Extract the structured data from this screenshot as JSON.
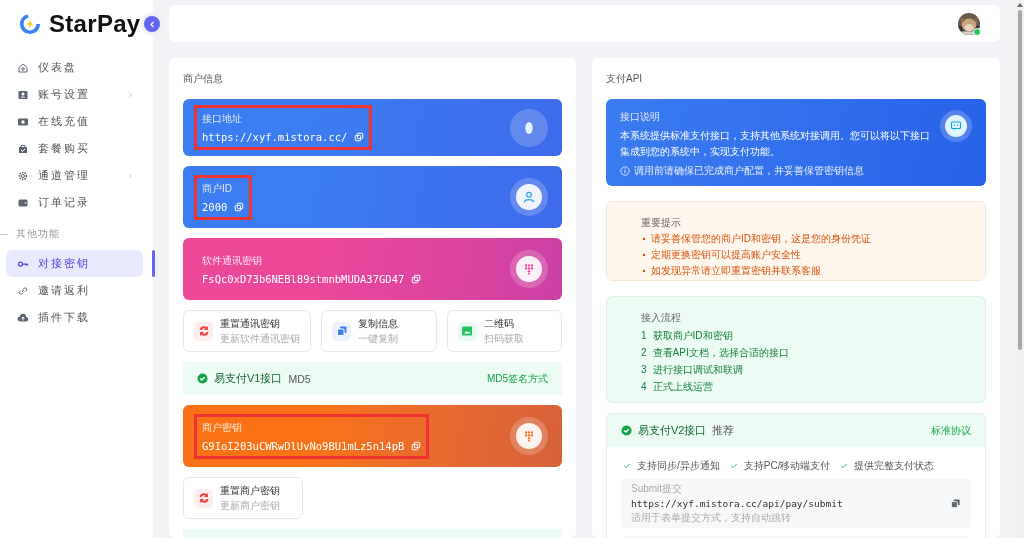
{
  "brand": {
    "name": "StarPay"
  },
  "sidebar": {
    "items": [
      {
        "label": "仪表盘",
        "has_submenu": false,
        "selected": false
      },
      {
        "label": "账号设置",
        "has_submenu": true,
        "selected": false
      },
      {
        "label": "在线充值",
        "has_submenu": false,
        "selected": false
      },
      {
        "label": "套餐购买",
        "has_submenu": false,
        "selected": false
      },
      {
        "label": "通道管理",
        "has_submenu": true,
        "selected": false
      },
      {
        "label": "订单记录",
        "has_submenu": false,
        "selected": false
      }
    ],
    "section": {
      "title": "其他功能",
      "items": [
        {
          "label": "对接密钥",
          "has_submenu": false,
          "selected": true
        },
        {
          "label": "邀请返利",
          "has_submenu": false,
          "selected": false
        },
        {
          "label": "插件下载",
          "has_submenu": false,
          "selected": false
        }
      ]
    }
  },
  "header": {
    "user": {
      "online": true
    }
  },
  "merchant_panel": {
    "title": "商户信息",
    "blocks": [
      {
        "kind": "credential",
        "color": "#3b7cf0",
        "label": "接口地址",
        "value": "https://xyf.mistora.cc/",
        "highlighted": true
      },
      {
        "kind": "credential",
        "color": "#3b7cf0",
        "label": "商户ID",
        "value": "2000",
        "highlighted": true
      },
      {
        "kind": "credential",
        "color": "#ec4899",
        "label": "软件通讯密钥",
        "value": "FsQc0xD73b6NEBl89stmnbMUDA37GD47",
        "highlighted": false
      },
      {
        "kind": "actions",
        "items": [
          {
            "kind": "reset",
            "title": "重置通讯密钥",
            "subtitle": "更新软件通讯密钥",
            "color": "#ef4444"
          },
          {
            "kind": "copy",
            "title": "复制信息",
            "subtitle": "一键复制",
            "color": "#3b82f6"
          },
          {
            "kind": "qrcode",
            "title": "二维码",
            "subtitle": "扫码获取",
            "color": "#22c55e"
          }
        ]
      },
      {
        "kind": "protocol",
        "name": "易支付V1接口",
        "tag": "MD5",
        "note": "MD5签名方式"
      },
      {
        "kind": "credential",
        "color": "#f97316",
        "label": "商户密钥",
        "value": "G9IoI203uCWRwDlUvNo9BU1mLz5n14pB",
        "highlighted": true
      },
      {
        "kind": "actions",
        "items": [
          {
            "kind": "reset",
            "title": "重置商户密钥",
            "subtitle": "更新商户密钥",
            "color": "#ef4444"
          }
        ]
      }
    ]
  },
  "api_panel": {
    "title": "支付API",
    "intro": {
      "label": "接口说明",
      "text": "本系统提供标准支付接口，支持其他系统对接调用。您可以将以下接口集成到您的系统中，实现支付功能。",
      "note": "调用前请确保已完成商户配置，并妥善保管密钥信息"
    },
    "notice": {
      "title": "重要提示",
      "items": [
        "请妥善保管您的商户ID和密钥，这是您的身份凭证",
        "定期更换密钥可以提高账户安全性",
        "如发现异常请立即重置密钥并联系客服"
      ]
    },
    "steps": {
      "title": "接入流程",
      "items": [
        {
          "number": "1",
          "text": "获取商户ID和密钥"
        },
        {
          "number": "2",
          "text": "查看API文档，选择合适的接口"
        },
        {
          "number": "3",
          "text": "进行接口调试和联调"
        },
        {
          "number": "4",
          "text": "正式上线运营"
        }
      ]
    },
    "v2": {
      "name": "易支付V2接口",
      "tag": "推荐",
      "note": "标准协议",
      "features": [
        "支持同步/异步通知",
        "支持PC/移动端支付",
        "提供完整支付状态"
      ],
      "endpoints": [
        {
          "label": "Submit提交",
          "url": "https://xyf.mistora.cc/api/pay/submit",
          "hint": "适用于表单提交方式，支持自动跳转"
        }
      ]
    }
  }
}
